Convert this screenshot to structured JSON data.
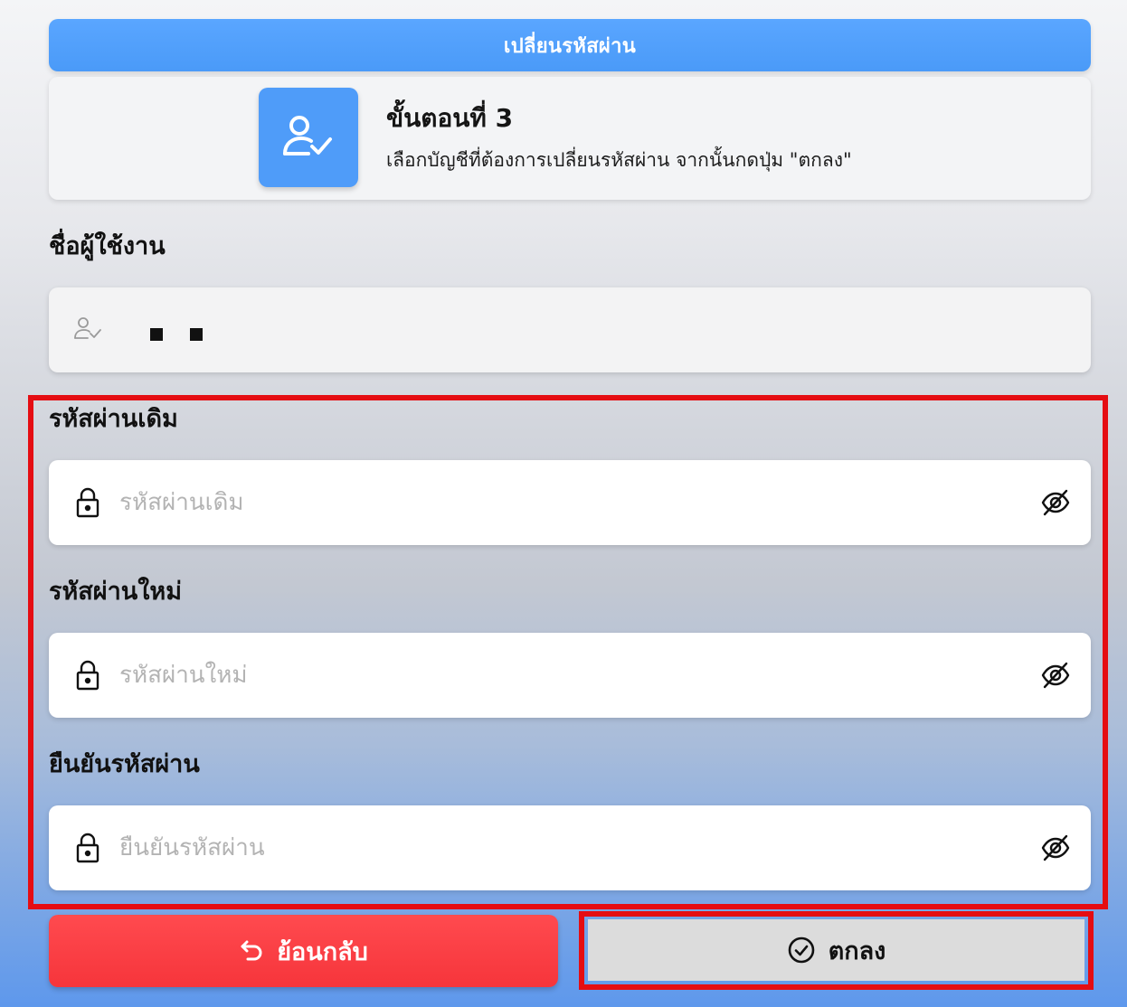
{
  "header": {
    "title": "เปลี่ยนรหัสผ่าน"
  },
  "step": {
    "icon": "user-check-icon",
    "title": "ขั้นตอนที่ 3",
    "description": "เลือกบัญชีที่ต้องการเปลี่ยนรหัสผ่าน จากนั้นกดปุ่ม \"ตกลง\""
  },
  "username": {
    "label": "ชื่อผู้ใช้งาน",
    "icon": "user-check-icon"
  },
  "old_password": {
    "label": "รหัสผ่านเดิม",
    "placeholder": "รหัสผ่านเดิม",
    "icon": "lock-icon",
    "toggle_icon": "eye-off-icon"
  },
  "new_password": {
    "label": "รหัสผ่านใหม่",
    "placeholder": "รหัสผ่านใหม่",
    "icon": "lock-icon",
    "toggle_icon": "eye-off-icon"
  },
  "confirm_password": {
    "label": "ยืนยันรหัสผ่าน",
    "placeholder": "ยืนยันรหัสผ่าน",
    "icon": "lock-icon",
    "toggle_icon": "eye-off-icon"
  },
  "actions": {
    "back_label": "ย้อนกลับ",
    "back_icon": "undo-arrow-icon",
    "ok_label": "ตกลง",
    "ok_icon": "check-circle-icon"
  },
  "colors": {
    "primary": "#4f9cf9",
    "danger": "#f6353b",
    "highlight": "#e50d12",
    "ok_button": "#dcdcdc"
  }
}
